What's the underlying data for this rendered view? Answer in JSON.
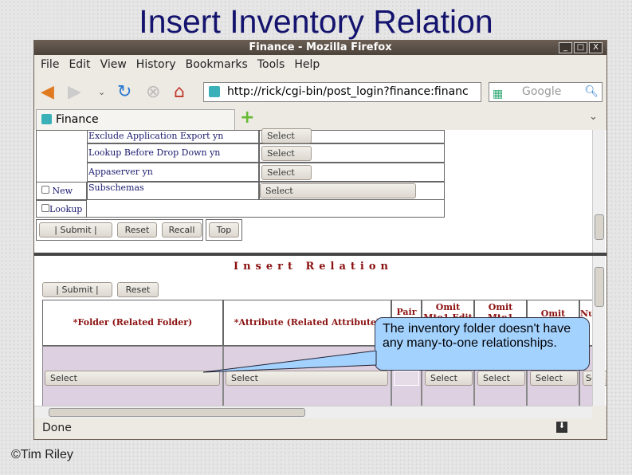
{
  "slide": {
    "title": "Insert Inventory Relation",
    "footer": "©Tim Riley"
  },
  "browser": {
    "window_title": "Finance - Mozilla Firefox",
    "menu": [
      "File",
      "Edit",
      "View",
      "History",
      "Bookmarks",
      "Tools",
      "Help"
    ],
    "url": "http://rick/cgi-bin/post_login?finance:financ",
    "search_placeholder": "Google",
    "tab_label": "Finance",
    "status": "Done"
  },
  "upper_form": {
    "rows": [
      {
        "label": "Exclude Application Export yn",
        "value": "Select"
      },
      {
        "label": "Lookup Before Drop Down yn",
        "value": "Select"
      },
      {
        "label": "Appaserver yn",
        "value": "Select"
      },
      {
        "label": "Subschemas",
        "value": "Select"
      }
    ],
    "checkboxes": [
      "New",
      "Lookup"
    ],
    "buttons": [
      "|   Submit   |",
      "Reset",
      "Recall",
      "Top"
    ]
  },
  "insert_relation": {
    "heading": "Insert Relation",
    "buttons": [
      "|   Submit   |",
      "Reset"
    ],
    "columns": [
      "*Folder (Related Folder)",
      "*Attribute (Related Attribute)",
      "Pair",
      "Omit Mto1 Edit",
      "Omit Mto1",
      "Omit",
      "Nu"
    ],
    "row_values": [
      "Select",
      "Select",
      "",
      "Select",
      "Select",
      "Select",
      "Se"
    ]
  },
  "callout": {
    "text": "The inventory folder doesn't have any many-to-one relationships.",
    "color": "#a4d2ff"
  }
}
